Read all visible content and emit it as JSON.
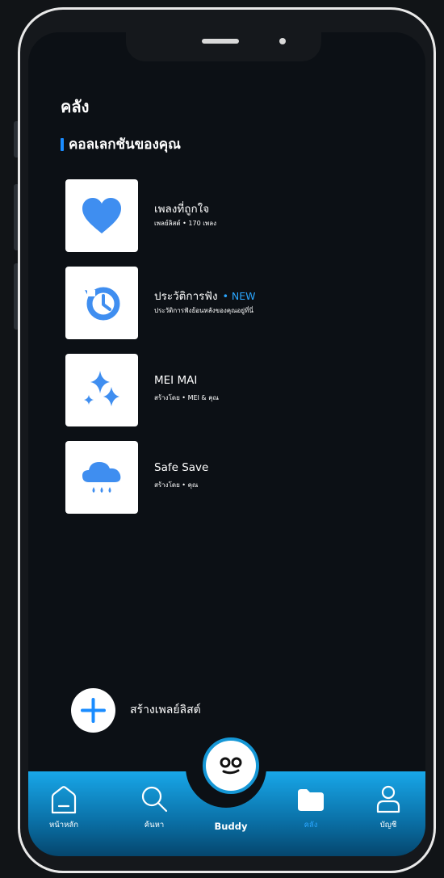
{
  "header": {
    "title": "คลัง"
  },
  "section": {
    "title": "คอลเลกชันของคุณ"
  },
  "collections": [
    {
      "title": "เพลงที่ถูกใจ",
      "badge": "",
      "subtitle": "เพลย์ลิสต์ • 170 เพลง",
      "icon": "heart-icon"
    },
    {
      "title": "ประวัติการฟัง",
      "badge": "• NEW",
      "subtitle": "ประวัติการฟังย้อนหลังของคุณอยู่ที่นี่",
      "icon": "history-icon"
    },
    {
      "title": "MEI MAI",
      "badge": "",
      "subtitle": "สร้างโดย • MEI & คุณ",
      "icon": "sparkles-icon"
    },
    {
      "title": "Safe Save",
      "badge": "",
      "subtitle": "สร้างโดย • คุณ",
      "icon": "rain-cloud-icon"
    }
  ],
  "create_playlist": {
    "label": "สร้างเพลย์ลิสต์",
    "icon": "plus-icon"
  },
  "nav": {
    "home": "หน้าหลัก",
    "search": "ค้นหา",
    "buddy": "Buddy",
    "library": "คลัง",
    "account": "บัญชี"
  },
  "colors": {
    "accent": "#2aa6ff",
    "nav_gradient_top": "#18a7e9",
    "background": "#0c1015"
  }
}
